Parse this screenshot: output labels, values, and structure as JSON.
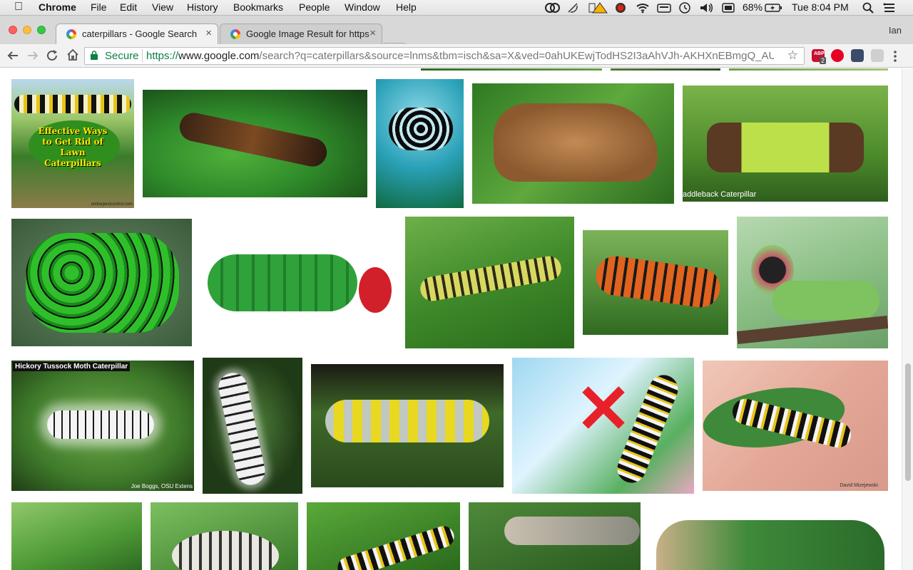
{
  "menubar": {
    "app": "Chrome",
    "items": [
      "File",
      "Edit",
      "View",
      "History",
      "Bookmarks",
      "People",
      "Window",
      "Help"
    ],
    "battery": "68%",
    "clock": "Tue 8:04 PM"
  },
  "tabs": [
    {
      "title": "caterpillars - Google Search",
      "active": true
    },
    {
      "title": "Google Image Result for https",
      "active": false
    }
  ],
  "profile": "Ian",
  "toolbar": {
    "secure_label": "Secure",
    "url_scheme": "https://",
    "url_host": "www.google.com",
    "url_path": "/search?q=caterpillars&source=lnms&tbm=isch&sa=X&ved=0ahUKEwjTodHS2I3aAhVJh-AKHXnEBmgQ_AUI...",
    "ext_badge": "2"
  },
  "images": [
    {
      "name": "effective-ways-caption",
      "text": "Effective Ways to Get Rid of Lawn Caterpillars",
      "credit": "onlinepestcontrol.com"
    },
    {
      "name": "saddleback-caption",
      "text": "addleback Caterpillar"
    },
    {
      "name": "hickory-caption",
      "text": "Hickory Tussock Moth Caterpillar",
      "credit": "Joe Boggs, OSU Extens"
    },
    {
      "name": "monarch-caption",
      "credit": "David Mizejewski"
    }
  ]
}
